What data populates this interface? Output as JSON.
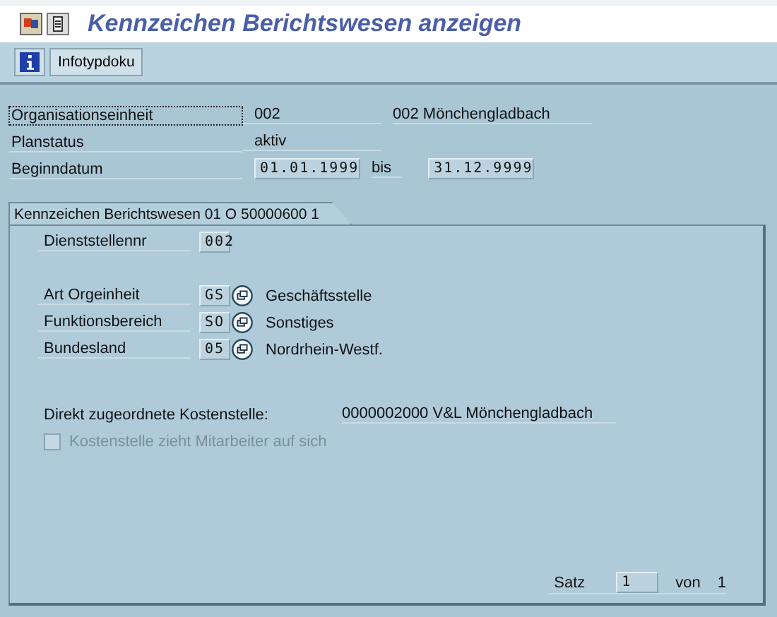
{
  "window": {
    "title": "Kennzeichen Berichtswesen anzeigen"
  },
  "toolbar": {
    "buttons": [
      {
        "kind": "info-icon"
      },
      {
        "kind": "text",
        "label": "Infotypdoku"
      }
    ]
  },
  "header_fields": [
    {
      "label": "Organisationseinheit",
      "focused": true,
      "value": "002",
      "boxed": false,
      "text": "002 Mönchengladbach"
    },
    {
      "label": "Planstatus",
      "focused": false,
      "value": "aktiv",
      "boxed": false
    },
    {
      "label": "Beginndatum",
      "focused": false,
      "value": "01.01.1999",
      "boxed": true,
      "separator": "bis",
      "end_value": "31.12.9999"
    }
  ],
  "tab": {
    "label": "Kennzeichen Berichtswesen 01 O  50000600 1"
  },
  "fields": [
    {
      "kind": "field",
      "label": "Dienststellennr",
      "value": "002"
    },
    {
      "kind": "gap"
    },
    {
      "kind": "lookup",
      "label": "Art Orgeinheit",
      "value": "GS",
      "text": "Geschäftsstelle"
    },
    {
      "kind": "lookup",
      "label": "Funktionsbereich",
      "value": "SO",
      "text": "Sonstiges"
    },
    {
      "kind": "lookup",
      "label": "Bundesland",
      "value": "05",
      "text": "Nordrhein-Westf."
    },
    {
      "kind": "gap"
    },
    {
      "kind": "display",
      "label": "Direkt zugeordnete Kostenstelle:",
      "value": "0000002000  V&L Mönchengladbach"
    },
    {
      "kind": "checkbox",
      "label": "Kostenstelle zieht Mitarbeiter auf sich",
      "checked": false,
      "disabled": true
    }
  ],
  "footer": {
    "label": "Satz",
    "value": "1",
    "separator": "von",
    "total": "1"
  }
}
